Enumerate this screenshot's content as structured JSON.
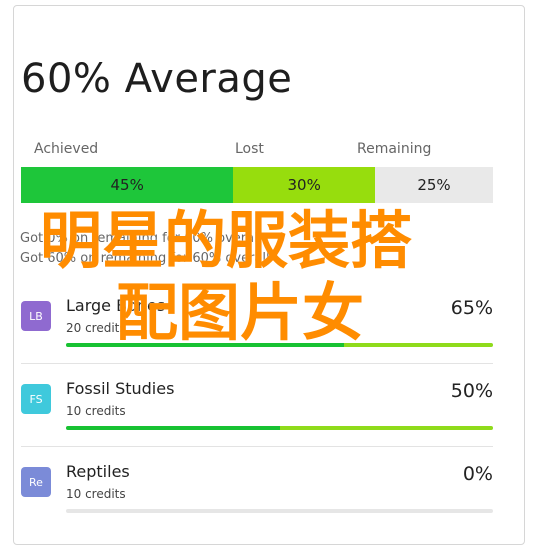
{
  "summary": {
    "title": "60% Average",
    "legend": {
      "achieved": "Achieved",
      "lost": "Lost",
      "remaining": "Remaining"
    },
    "segments": [
      {
        "key": "achieved",
        "label": "45%",
        "value": 45,
        "color": "#1ec63a"
      },
      {
        "key": "lost",
        "label": "30%",
        "value": 30,
        "color": "#97dd0d"
      },
      {
        "key": "remaining",
        "label": "25%",
        "value": 25,
        "color": "#e9e9e9"
      }
    ],
    "notes": [
      "Got 0% on remaining for 60% overall",
      "Got 60% on remaining for 60% overall"
    ]
  },
  "courses": [
    {
      "abbr": "LB",
      "color": "#8f6ad0",
      "name": "Large Bones",
      "credits": "20 credits",
      "percent": "65%",
      "achieved": 65,
      "lost": 35
    },
    {
      "abbr": "FS",
      "color": "#3fc9dc",
      "name": "Fossil Studies",
      "credits": "10 credits",
      "percent": "50%",
      "achieved": 50,
      "lost": 50
    },
    {
      "abbr": "Re",
      "color": "#7b8bd8",
      "name": "Reptiles",
      "credits": "10 credits",
      "percent": "0%",
      "achieved": 0,
      "lost": 0
    }
  ],
  "watermark": {
    "line1": "明星的服装搭",
    "line2": "配图片女"
  }
}
